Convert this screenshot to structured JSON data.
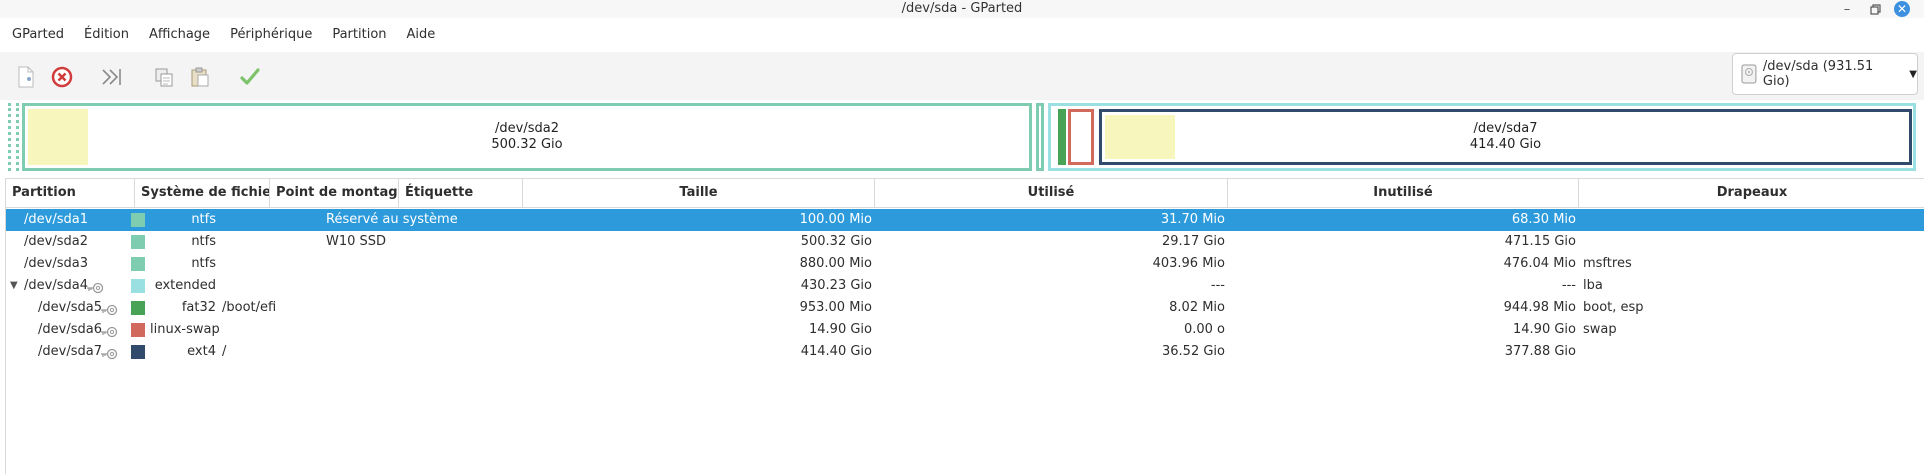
{
  "window": {
    "title": "/dev/sda - GParted"
  },
  "menu": [
    "GParted",
    "Édition",
    "Affichage",
    "Périphérique",
    "Partition",
    "Aide"
  ],
  "toolbar": {
    "icons": [
      "new-document-icon",
      "cancel-icon",
      "skip-icon",
      "copy-icon",
      "paste-icon",
      "apply-check-icon"
    ]
  },
  "device": {
    "label": "/dev/sda (931.51 Gio)"
  },
  "diskmap": {
    "sda2": {
      "name": "/dev/sda2",
      "size": "500.32 Gio"
    },
    "sda7": {
      "name": "/dev/sda7",
      "size": "414.40 Gio"
    }
  },
  "columns": {
    "partition": "Partition",
    "fs": "Système de fichiers",
    "mount": "Point de montage",
    "label": "Étiquette",
    "size": "Taille",
    "used": "Utilisé",
    "unused": "Inutilisé",
    "flags": "Drapeaux"
  },
  "rows": [
    {
      "partition": "/dev/sda1",
      "fs": "ntfs",
      "color": "#7fcdb0",
      "mount": "",
      "label": "Réservé au système",
      "size": "100.00 Mio",
      "used": "31.70 Mio",
      "unused": "68.30 Mio",
      "flags": "",
      "level": 0,
      "mounted": false,
      "selected": true
    },
    {
      "partition": "/dev/sda2",
      "fs": "ntfs",
      "color": "#7fcdb0",
      "mount": "",
      "label": "W10 SSD",
      "size": "500.32 Gio",
      "used": "29.17 Gio",
      "unused": "471.15 Gio",
      "flags": "",
      "level": 0,
      "mounted": false,
      "selected": false
    },
    {
      "partition": "/dev/sda3",
      "fs": "ntfs",
      "color": "#7fcdb0",
      "mount": "",
      "label": "",
      "size": "880.00 Mio",
      "used": "403.96 Mio",
      "unused": "476.04 Mio",
      "flags": "msftres",
      "level": 0,
      "mounted": false,
      "selected": false
    },
    {
      "partition": "/dev/sda4",
      "fs": "extended",
      "color": "#9ae0e3",
      "mount": "",
      "label": "",
      "size": "430.23 Gio",
      "used": "---",
      "unused": "---",
      "flags": "lba",
      "level": 0,
      "mounted": true,
      "expander": true,
      "selected": false
    },
    {
      "partition": "/dev/sda5",
      "fs": "fat32",
      "color": "#49a356",
      "mount": "/boot/efi",
      "label": "",
      "size": "953.00 Mio",
      "used": "8.02 Mio",
      "unused": "944.98 Mio",
      "flags": "boot, esp",
      "level": 1,
      "mounted": true,
      "selected": false
    },
    {
      "partition": "/dev/sda6",
      "fs": "linux-swap",
      "color": "#d16a5c",
      "mount": "",
      "label": "",
      "size": "14.90 Gio",
      "used": "0.00 o",
      "unused": "14.90 Gio",
      "flags": "swap",
      "level": 1,
      "mounted": true,
      "selected": false
    },
    {
      "partition": "/dev/sda7",
      "fs": "ext4",
      "color": "#304b6b",
      "mount": "/",
      "label": "",
      "size": "414.40 Gio",
      "used": "36.52 Gio",
      "unused": "377.88 Gio",
      "flags": "",
      "level": 1,
      "mounted": true,
      "selected": false
    }
  ]
}
